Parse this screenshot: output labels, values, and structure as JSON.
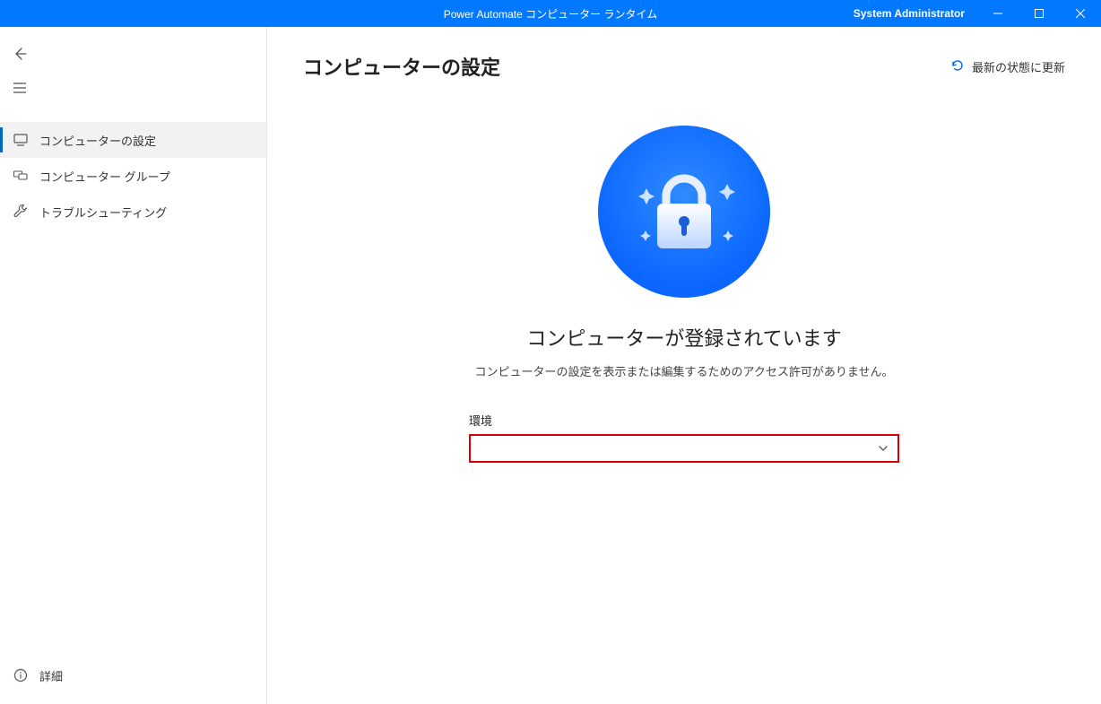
{
  "titlebar": {
    "title": "Power Automate コンピューター ランタイム",
    "user": "System Administrator"
  },
  "sidebar": {
    "items": [
      {
        "label": "コンピューターの設定"
      },
      {
        "label": "コンピューター グループ"
      },
      {
        "label": "トラブルシューティング"
      }
    ],
    "details": "詳細"
  },
  "main": {
    "title": "コンピューターの設定",
    "refresh": "最新の状態に更新",
    "status_title": "コンピューターが登録されています",
    "status_desc": "コンピューターの設定を表示または編集するためのアクセス許可がありません。",
    "env_label": "環境",
    "env_value": ""
  }
}
